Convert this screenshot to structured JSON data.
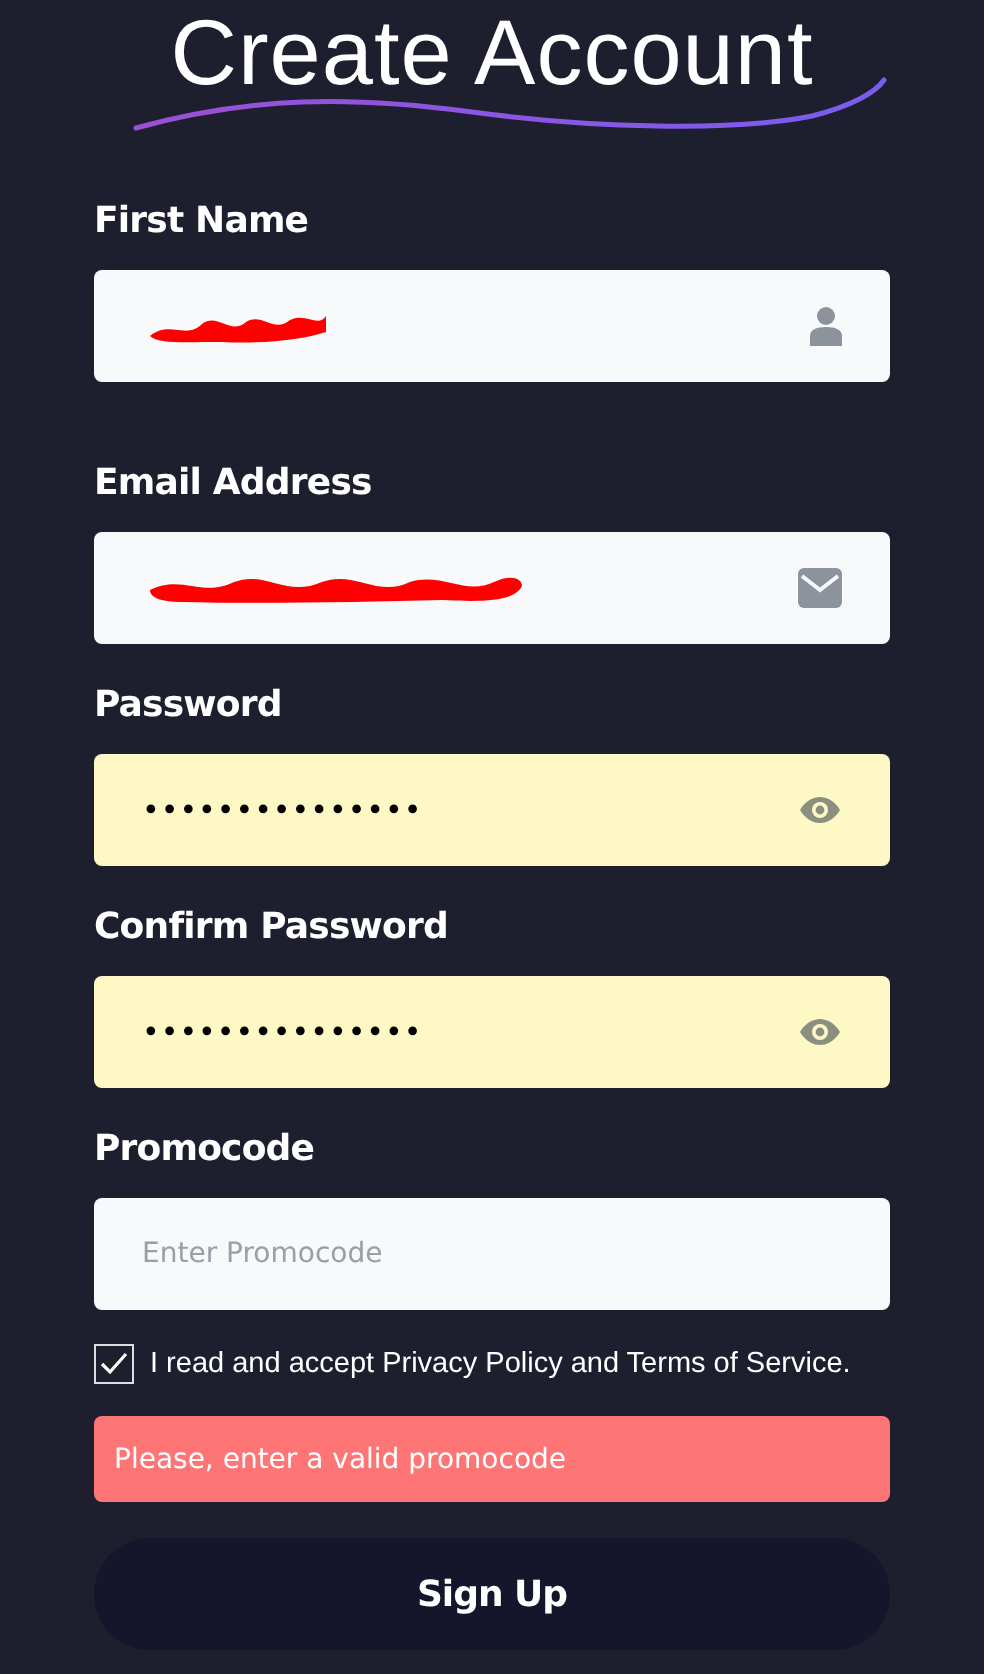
{
  "title": "Create Account",
  "fields": [
    {
      "label": "First Name",
      "kind": "name",
      "redacted": true,
      "autofilled": false
    },
    {
      "label": "Email Address",
      "kind": "email",
      "redacted": true,
      "autofilled": false
    },
    {
      "label": "Password",
      "kind": "password",
      "value": "•••••••••••••••",
      "autofilled": true
    },
    {
      "label": "Confirm Password",
      "kind": "password",
      "value": "•••••••••••••••",
      "autofilled": true
    },
    {
      "label": "Promocode",
      "kind": "promocode",
      "placeholder": "Enter Promocode",
      "autofilled": false
    }
  ],
  "terms": {
    "text": "I read and accept Privacy Policy and Terms of Service.",
    "checked": true
  },
  "error": "Please, enter a valid promocode",
  "submit": "Sign Up"
}
